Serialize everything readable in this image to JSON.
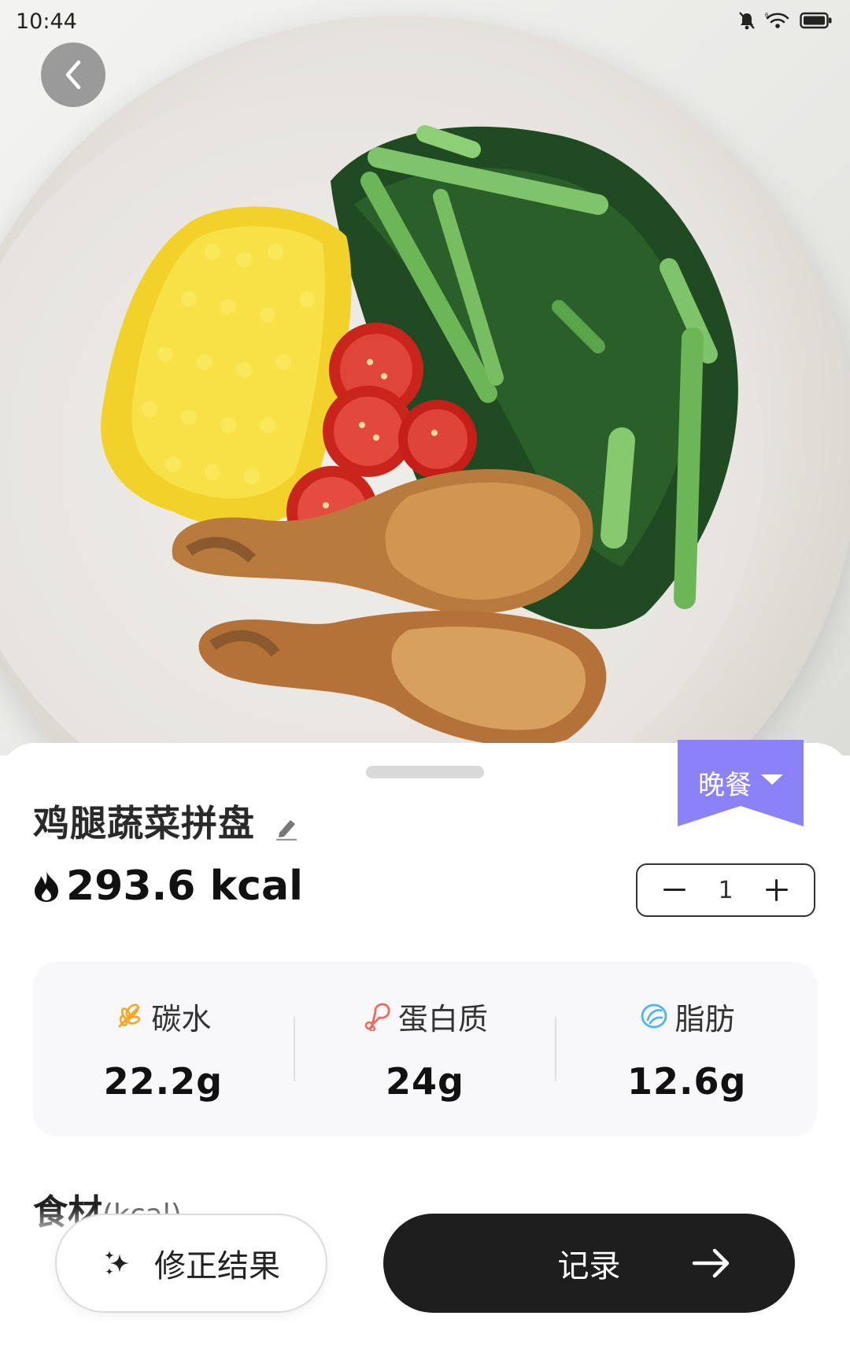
{
  "status_bar": {
    "time": "10:44",
    "icons": [
      "bell-muted-icon",
      "wifi-icon",
      "battery-icon"
    ]
  },
  "photo": {
    "icon": "back-arrow-icon"
  },
  "meal": {
    "selected": "晚餐",
    "color": "#8B82F7"
  },
  "dish": {
    "name": "鸡腿蔬菜拼盘",
    "kcal": "293.6 kcal",
    "quantity": "1"
  },
  "macros": [
    {
      "label": "碳水",
      "value": "22.2g",
      "icon": "wheat-icon",
      "color": "#F5A623"
    },
    {
      "label": "蛋白质",
      "value": "24g",
      "icon": "drumstick-icon",
      "color": "#F06A5B"
    },
    {
      "label": "脂肪",
      "value": "12.6g",
      "icon": "oil-drop-icon",
      "color": "#4DB6E8"
    }
  ],
  "ingredients": {
    "title": "食材",
    "unit": "(kcal)"
  },
  "actions": {
    "fix_label": "修正结果",
    "record_label": "记录"
  }
}
